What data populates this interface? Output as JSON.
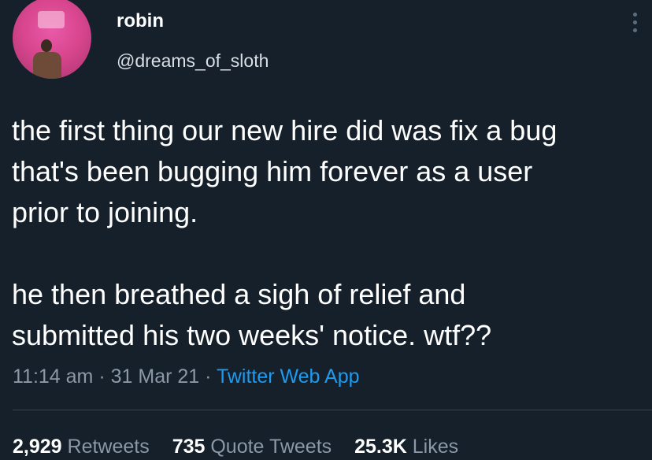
{
  "tweet": {
    "author": {
      "display_name": "robin",
      "handle": "@dreams_of_sloth"
    },
    "text": {
      "paragraph1": "the first thing our new hire did was fix a bug\nthat's been bugging him forever as a user\nprior to joining.",
      "paragraph2": "he then breathed a sigh of relief and\nsubmitted his two weeks' notice. wtf??"
    },
    "meta": {
      "time": "11:14 am",
      "separator": " · ",
      "date": "31 Mar 21",
      "source": "Twitter Web App"
    },
    "stats": {
      "retweets_count": "2,929",
      "retweets_label": "Retweets",
      "quotes_count": "735",
      "quotes_label": "Quote Tweets",
      "likes_count": "25.3K",
      "likes_label": "Likes"
    }
  },
  "icons": {
    "more": "more-vertical-icon"
  },
  "colors": {
    "background": "#15202b",
    "text": "#ffffff",
    "secondary": "#8b98a5",
    "link": "#1d9bf0",
    "divider": "#38444d"
  }
}
